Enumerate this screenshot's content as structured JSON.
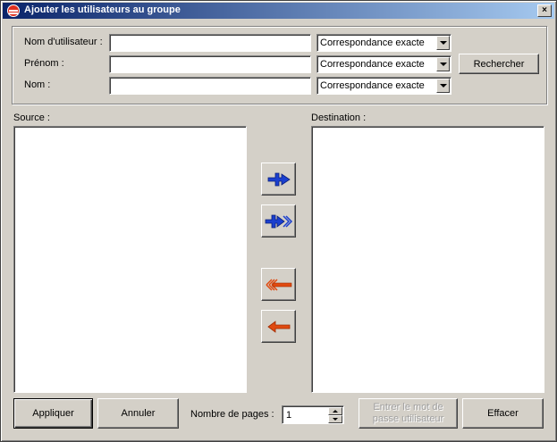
{
  "window": {
    "title": "Ajouter les utilisateurs au groupe",
    "close_glyph": "×"
  },
  "search": {
    "username_label": "Nom d'utilisateur :",
    "firstname_label": "Prénom :",
    "lastname_label": "Nom :",
    "username_value": "",
    "firstname_value": "",
    "lastname_value": "",
    "match_options": [
      "Correspondance exacte",
      "Correspondance exacte",
      "Correspondance exacte"
    ],
    "search_button": "Rechercher"
  },
  "lists": {
    "source_label": "Source :",
    "destination_label": "Destination :"
  },
  "transfer": {
    "add_one_icon": "arrow-right-blue-icon",
    "add_all_icon": "double-arrow-right-blue-icon",
    "remove_all_icon": "double-arrow-left-red-icon",
    "remove_one_icon": "arrow-left-red-icon",
    "blue": "#1a3fcf",
    "red": "#e04a10"
  },
  "footer": {
    "apply_button": "Appliquer",
    "cancel_button": "Annuler",
    "pages_label": "Nombre de pages :",
    "pages_value": "1",
    "password_button_line1": "Entrer le mot de",
    "password_button_line2": "passe utilisateur",
    "clear_button": "Effacer"
  }
}
